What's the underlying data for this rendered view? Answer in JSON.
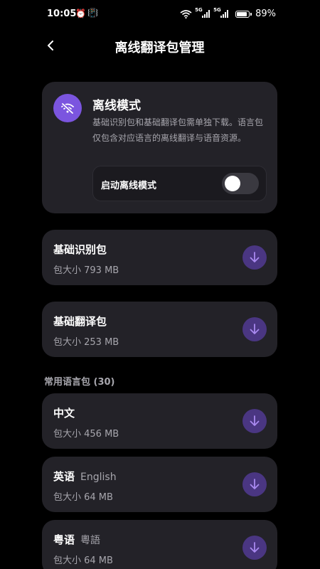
{
  "status": {
    "time": "10:05",
    "battery": "89%",
    "network_1": "5G",
    "network_2": "5G"
  },
  "header": {
    "title": "离线翻译包管理"
  },
  "offline_mode": {
    "title": "离线模式",
    "description": "基础识别包和基础翻译包需单独下载。语言包仅包含对应语言的离线翻译与语音资源。",
    "toggle_label": "启动离线模式",
    "enabled": false
  },
  "base_packages": [
    {
      "name": "基础识别包",
      "size": "包大小 793 MB"
    },
    {
      "name": "基础翻译包",
      "size": "包大小 253 MB"
    }
  ],
  "language_section": {
    "title": "常用语言包 (30)"
  },
  "language_packages": [
    {
      "name": "中文",
      "alt": "",
      "size": "包大小 456 MB"
    },
    {
      "name": "英语",
      "alt": "English",
      "size": "包大小 64 MB"
    },
    {
      "name": "粤语",
      "alt": "粵語",
      "size": "包大小 64 MB"
    }
  ],
  "colors": {
    "accent": "#7b55df",
    "card": "#232228",
    "download": "#4a3682"
  }
}
